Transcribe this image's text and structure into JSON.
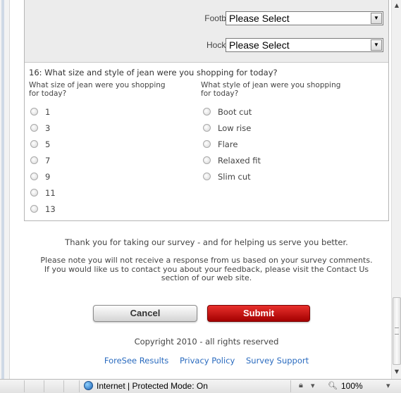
{
  "sports": [
    {
      "label": "Football",
      "value": "Please Select"
    },
    {
      "label": "Hockey",
      "value": "Please Select"
    }
  ],
  "question": {
    "title": "16: What size and style of jean were you shopping for today?",
    "size_header": "What size of jean were you shopping for today?",
    "style_header": "What style of jean were you shopping for today?",
    "sizes": [
      "1",
      "3",
      "5",
      "7",
      "9",
      "11",
      "13"
    ],
    "styles": [
      "Boot cut",
      "Low rise",
      "Flare",
      "Relaxed fit",
      "Slim cut"
    ]
  },
  "footer": {
    "thank_you": "Thank you for taking our survey - and for helping us serve you better.",
    "note": "Please note you will not receive a response from us based on your survey comments. If you would like us to contact you about your feedback, please visit the Contact Us section of our web site.",
    "cancel_label": "Cancel",
    "submit_label": "Submit",
    "copyright": "Copyright 2010 - all rights reserved",
    "links": [
      "ForeSee Results",
      "Privacy Policy",
      "Survey Support"
    ]
  },
  "statusbar": {
    "zone": "Internet | Protected Mode: On",
    "zoom": "100%"
  },
  "colors": {
    "submit": "#c00000",
    "link": "#2a6bbf",
    "sports_bg": "#ececec"
  },
  "icons": {
    "dropdown": "chevron-down-icon",
    "globe": "globe-icon",
    "zoom": "magnifier-icon",
    "security": "lock-icon"
  }
}
